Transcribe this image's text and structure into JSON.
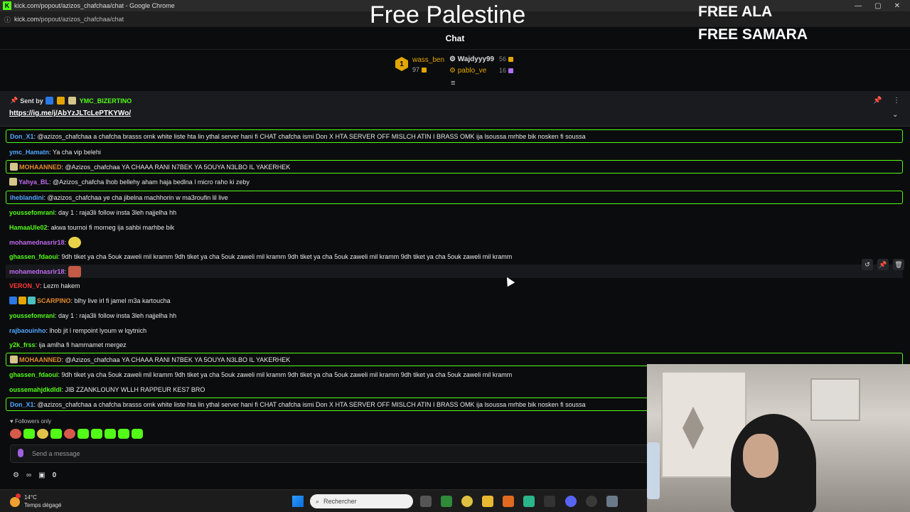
{
  "browser": {
    "window_title": "kick.com/popout/azizos_chafchaa/chat - Google Chrome",
    "url_domain": "kick.com",
    "url_path": "/popout/azizos_chafchaa/chat",
    "logo_letter": "K",
    "window_controls": [
      "—",
      "▢",
      "✕"
    ],
    "info_icon": "ⓘ"
  },
  "overlays": {
    "title": "Free Palestine",
    "free_1": "FREE ALA",
    "free_2": "FREE SAMARA"
  },
  "chat": {
    "header": "Chat",
    "filter_icon": "≡",
    "leaderboard": [
      {
        "rank": "1",
        "name": "wass_ben",
        "amount": "97"
      },
      {
        "name": "Wajdyyy99",
        "amount": "56"
      },
      {
        "name": "pablo_ve",
        "amount": "16"
      }
    ],
    "pinned": {
      "sent_by_label": "Sent by",
      "sender": "YMC_BIZERTINO",
      "link": "https://ig.me/j/AbYzJLTcLePTKYWo/",
      "pin_icon": "📌",
      "more_icon": "⋮",
      "expand_icon": "⌄"
    },
    "messages": [
      {
        "user": "Don_X1",
        "color": "#52a6ff",
        "text": "@azizos_chafchaa a chafcha brasss omk white liste hta lin ythal server hani fi CHAT chafcha ismi Don X HTA SERVER OFF MISLCH ATIN I BRASS OMK ija lsoussa mrhbe bik nosken fi soussa"
      },
      {
        "user": "ymc_Hamatn",
        "color": "#52a6ff",
        "text": "Ya cha vip belehi"
      },
      {
        "user": "MOHAANNED",
        "color": "#e38b2c",
        "text": "@Azizos_chafchaa YA CHAAA RANI N7BEK YA 5OUYA N3LBO IL YAKERHEK"
      },
      {
        "user": "Yahya_BL",
        "color": "#c06af0",
        "text": "@Azizos_chafcha lhob bellehy aham haja bedlna l micro raho ki zeby"
      },
      {
        "user": "iheblandini",
        "color": "#52a6ff",
        "text": "@azizos_chafchaa ye cha jibelna machhorin w ma3roufin lil live"
      },
      {
        "user": "youssefomrani",
        "color": "#53fc18",
        "text": "day 1 : raja3li follow insta 3leh najjelha hh"
      },
      {
        "user": "HamaaUle02",
        "color": "#53fc18",
        "text": "akwa tournoi fi morneg ija sahbi marhbe bik"
      },
      {
        "user": "mohamednasrir18",
        "color": "#c06af0",
        "text": ""
      },
      {
        "user": "ghassen_fdaoui",
        "color": "#53fc18",
        "text": "9dh tiket ya cha 5ouk zaweli mil kramm 9dh tiket ya cha 5ouk zaweli mil kramm 9dh tiket ya cha 5ouk zaweli mil kramm 9dh tiket ya cha 5ouk zaweli mil kramm"
      },
      {
        "user": "mohamednasrir18",
        "color": "#c06af0",
        "text": ""
      },
      {
        "user": "VERON_V",
        "color": "#ff3b3b",
        "text": "Lezm hakem"
      },
      {
        "user": "SCARPINO",
        "color": "#e38b2c",
        "text": "blhy live irl fi jamel m3a kartoucha"
      },
      {
        "user": "youssefomrani",
        "color": "#53fc18",
        "text": "day 1 : raja3li follow insta 3leh najjelha hh"
      },
      {
        "user": "rajbaouinho",
        "color": "#52a6ff",
        "text": "lhob jit l rempoint lyoum w lqytnich"
      },
      {
        "user": "y2k_frss",
        "color": "#53fc18",
        "text": "ija amlha fi hammamet mergez"
      },
      {
        "user": "MOHAANNED",
        "color": "#e38b2c",
        "text": "@Azizos_chafchaa YA CHAAA RANI N7BEK YA 5OUYA N3LBO IL YAKERHEK"
      },
      {
        "user": "ghassen_fdaoui",
        "color": "#53fc18",
        "text": "9dh tiket ya cha 5ouk zaweli mil kramm 9dh tiket ya cha 5ouk zaweli mil kramm 9dh tiket ya cha 5ouk zaweli mil kramm 9dh tiket ya cha 5ouk zaweli mil kramm"
      },
      {
        "user": "oussemahjdkdldl",
        "color": "#53fc18",
        "text": "JIB ZZANKLOUNY WLLH RAPPEUR KES7 BRO"
      },
      {
        "user": "Don_X1",
        "color": "#52a6ff",
        "text": "@azizos_chafchaa a chafcha brasss omk white liste hta lin ythal server hani fi CHAT chafcha ismi Don X HTA SERVER OFF MISLCH ATIN I BRASS OMK ija lsoussa mrhbe bik nosken fi soussa"
      }
    ],
    "followers_only": "Followers only",
    "send_placeholder": "Send a message",
    "bottom_count": "0",
    "hover_tools": [
      "↺",
      "📌",
      "🗑"
    ]
  },
  "taskbar": {
    "temperature": "14°C",
    "weather": "Temps dégagé",
    "search_placeholder": "Rechercher"
  }
}
